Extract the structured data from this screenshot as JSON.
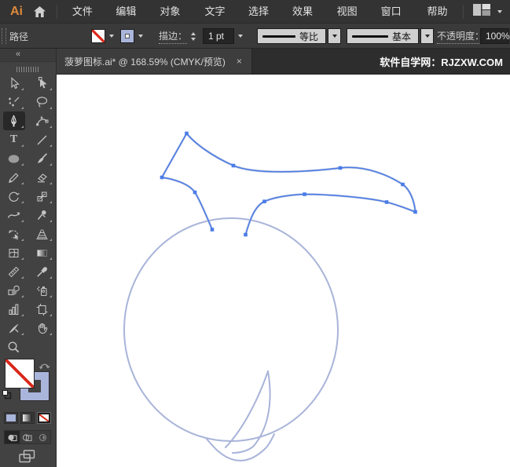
{
  "colors": {
    "selection_blue": "#4A7CE8",
    "artwork_stroke": "#A8B4D9",
    "stroke_swatch_periwinkle": "#AAB5DC",
    "logo_orange": "#DD8A3C",
    "none_slash_red": "#D92A1C",
    "ui_dark": "#333333",
    "toolbar_gray": "#424242",
    "canvas_white": "#FFFFFF"
  },
  "menu_bar": {
    "logo": "Ai",
    "menus": [
      {
        "label": "文件(F)"
      },
      {
        "label": "编辑(E)"
      },
      {
        "label": "对象(O)"
      },
      {
        "label": "文字(T)"
      },
      {
        "label": "选择(S)"
      },
      {
        "label": "效果(C)"
      },
      {
        "label": "视图(V)"
      },
      {
        "label": "窗口(W)"
      },
      {
        "label": "帮助(H)"
      }
    ],
    "workspace_switcher": "workspace-layout-icon"
  },
  "control_bar": {
    "panel_label": "路径",
    "fill_swatch": "无 (none)",
    "stroke_swatch": "periwinkle",
    "stroke_label": "描边：",
    "stroke_value": "1 pt",
    "profile_value": "等比",
    "brush_value": "基本",
    "opacity_label": "不透明度：",
    "opacity_value": "100%"
  },
  "tab_bar": {
    "document_title": "菠萝图标.ai* @ 168.59% (CMYK/预览)",
    "close": "×",
    "watermark": "软件自学网：RJZXW.COM"
  },
  "toolbar": {
    "collapse": "«",
    "type_glyph": "T",
    "tools": [
      {
        "name": "selection-tool",
        "label": "选择工具"
      },
      {
        "name": "direct-selection-tool",
        "label": "直接选择工具"
      },
      {
        "name": "magic-wand-tool",
        "label": "魔棒工具"
      },
      {
        "name": "lasso-tool",
        "label": "套索工具"
      },
      {
        "name": "pen-tool",
        "label": "钢笔工具",
        "selected": true
      },
      {
        "name": "curvature-tool",
        "label": "曲率工具"
      },
      {
        "name": "type-tool",
        "label": "文字工具"
      },
      {
        "name": "line-segment-tool",
        "label": "直线段工具"
      },
      {
        "name": "ellipse-tool",
        "label": "椭圆工具"
      },
      {
        "name": "paintbrush-tool",
        "label": "画笔工具"
      },
      {
        "name": "pencil-tool",
        "label": "铅笔工具"
      },
      {
        "name": "eraser-tool",
        "label": "橡皮擦工具"
      },
      {
        "name": "rotate-tool",
        "label": "旋转工具"
      },
      {
        "name": "scale-tool",
        "label": "比例缩放工具"
      },
      {
        "name": "width-tool",
        "label": "宽度工具"
      },
      {
        "name": "puppet-warp-tool",
        "label": "操控变形工具"
      },
      {
        "name": "shape-builder-tool",
        "label": "形状生成器工具"
      },
      {
        "name": "perspective-grid-tool",
        "label": "透视网格工具"
      },
      {
        "name": "mesh-tool",
        "label": "网格工具"
      },
      {
        "name": "gradient-tool",
        "label": "渐变工具"
      },
      {
        "name": "measure-tool",
        "label": "度量工具"
      },
      {
        "name": "eyedropper-tool",
        "label": "吸管工具"
      },
      {
        "name": "blend-tool",
        "label": "混合工具"
      },
      {
        "name": "symbol-sprayer-tool",
        "label": "符号喷枪工具"
      },
      {
        "name": "column-graph-tool",
        "label": "柱形图工具"
      },
      {
        "name": "artboard-tool",
        "label": "画板工具"
      },
      {
        "name": "slice-tool",
        "label": "切片工具"
      },
      {
        "name": "hand-tool",
        "label": "抓手工具"
      },
      {
        "name": "zoom-tool",
        "label": "缩放工具"
      }
    ],
    "fill_stroke": {
      "fill": "无",
      "stroke": "#AAB5DC",
      "buttons": [
        {
          "name": "color-button"
        },
        {
          "name": "gradient-button"
        },
        {
          "name": "none-button",
          "selected": true
        }
      ],
      "drawing_modes": [
        {
          "name": "draw-normal",
          "selected": true
        },
        {
          "name": "draw-behind"
        },
        {
          "name": "draw-inside"
        }
      ]
    }
  },
  "canvas": {
    "document_zoom": "168.59%",
    "artwork": "pineapple outline: body circle, bottom wave, inner leaf sliver, selected crown path with 12 anchor points"
  }
}
